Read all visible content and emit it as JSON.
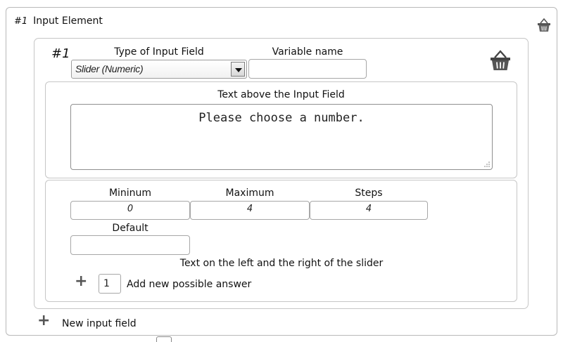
{
  "element": {
    "number": "#1",
    "title": "Input Element"
  },
  "input": {
    "number": "#1",
    "type_label": "Type of Input Field",
    "type_value": "Slider (Numeric)",
    "varname_label": "Variable name",
    "varname_value": ""
  },
  "text_above": {
    "label": "Text above the Input Field",
    "value": "Please choose a number."
  },
  "slider": {
    "min_label": "Mininum",
    "min_value": "0",
    "max_label": "Maximum",
    "max_value": "4",
    "steps_label": "Steps",
    "steps_value": "4",
    "default_label": "Default",
    "default_value": "",
    "side_text_label": "Text on the left and the right of the slider"
  },
  "answers": {
    "add_plus": "+",
    "count": "1",
    "add_label": "Add new possible answer"
  },
  "new_field": {
    "plus": "+",
    "label": "New input field"
  },
  "icons": {
    "delete_element": "basket-icon",
    "delete_input": "basket-icon",
    "add": "plus-icon",
    "resize": "resize-grip-icon",
    "dropdown": "chevron-down-icon"
  }
}
